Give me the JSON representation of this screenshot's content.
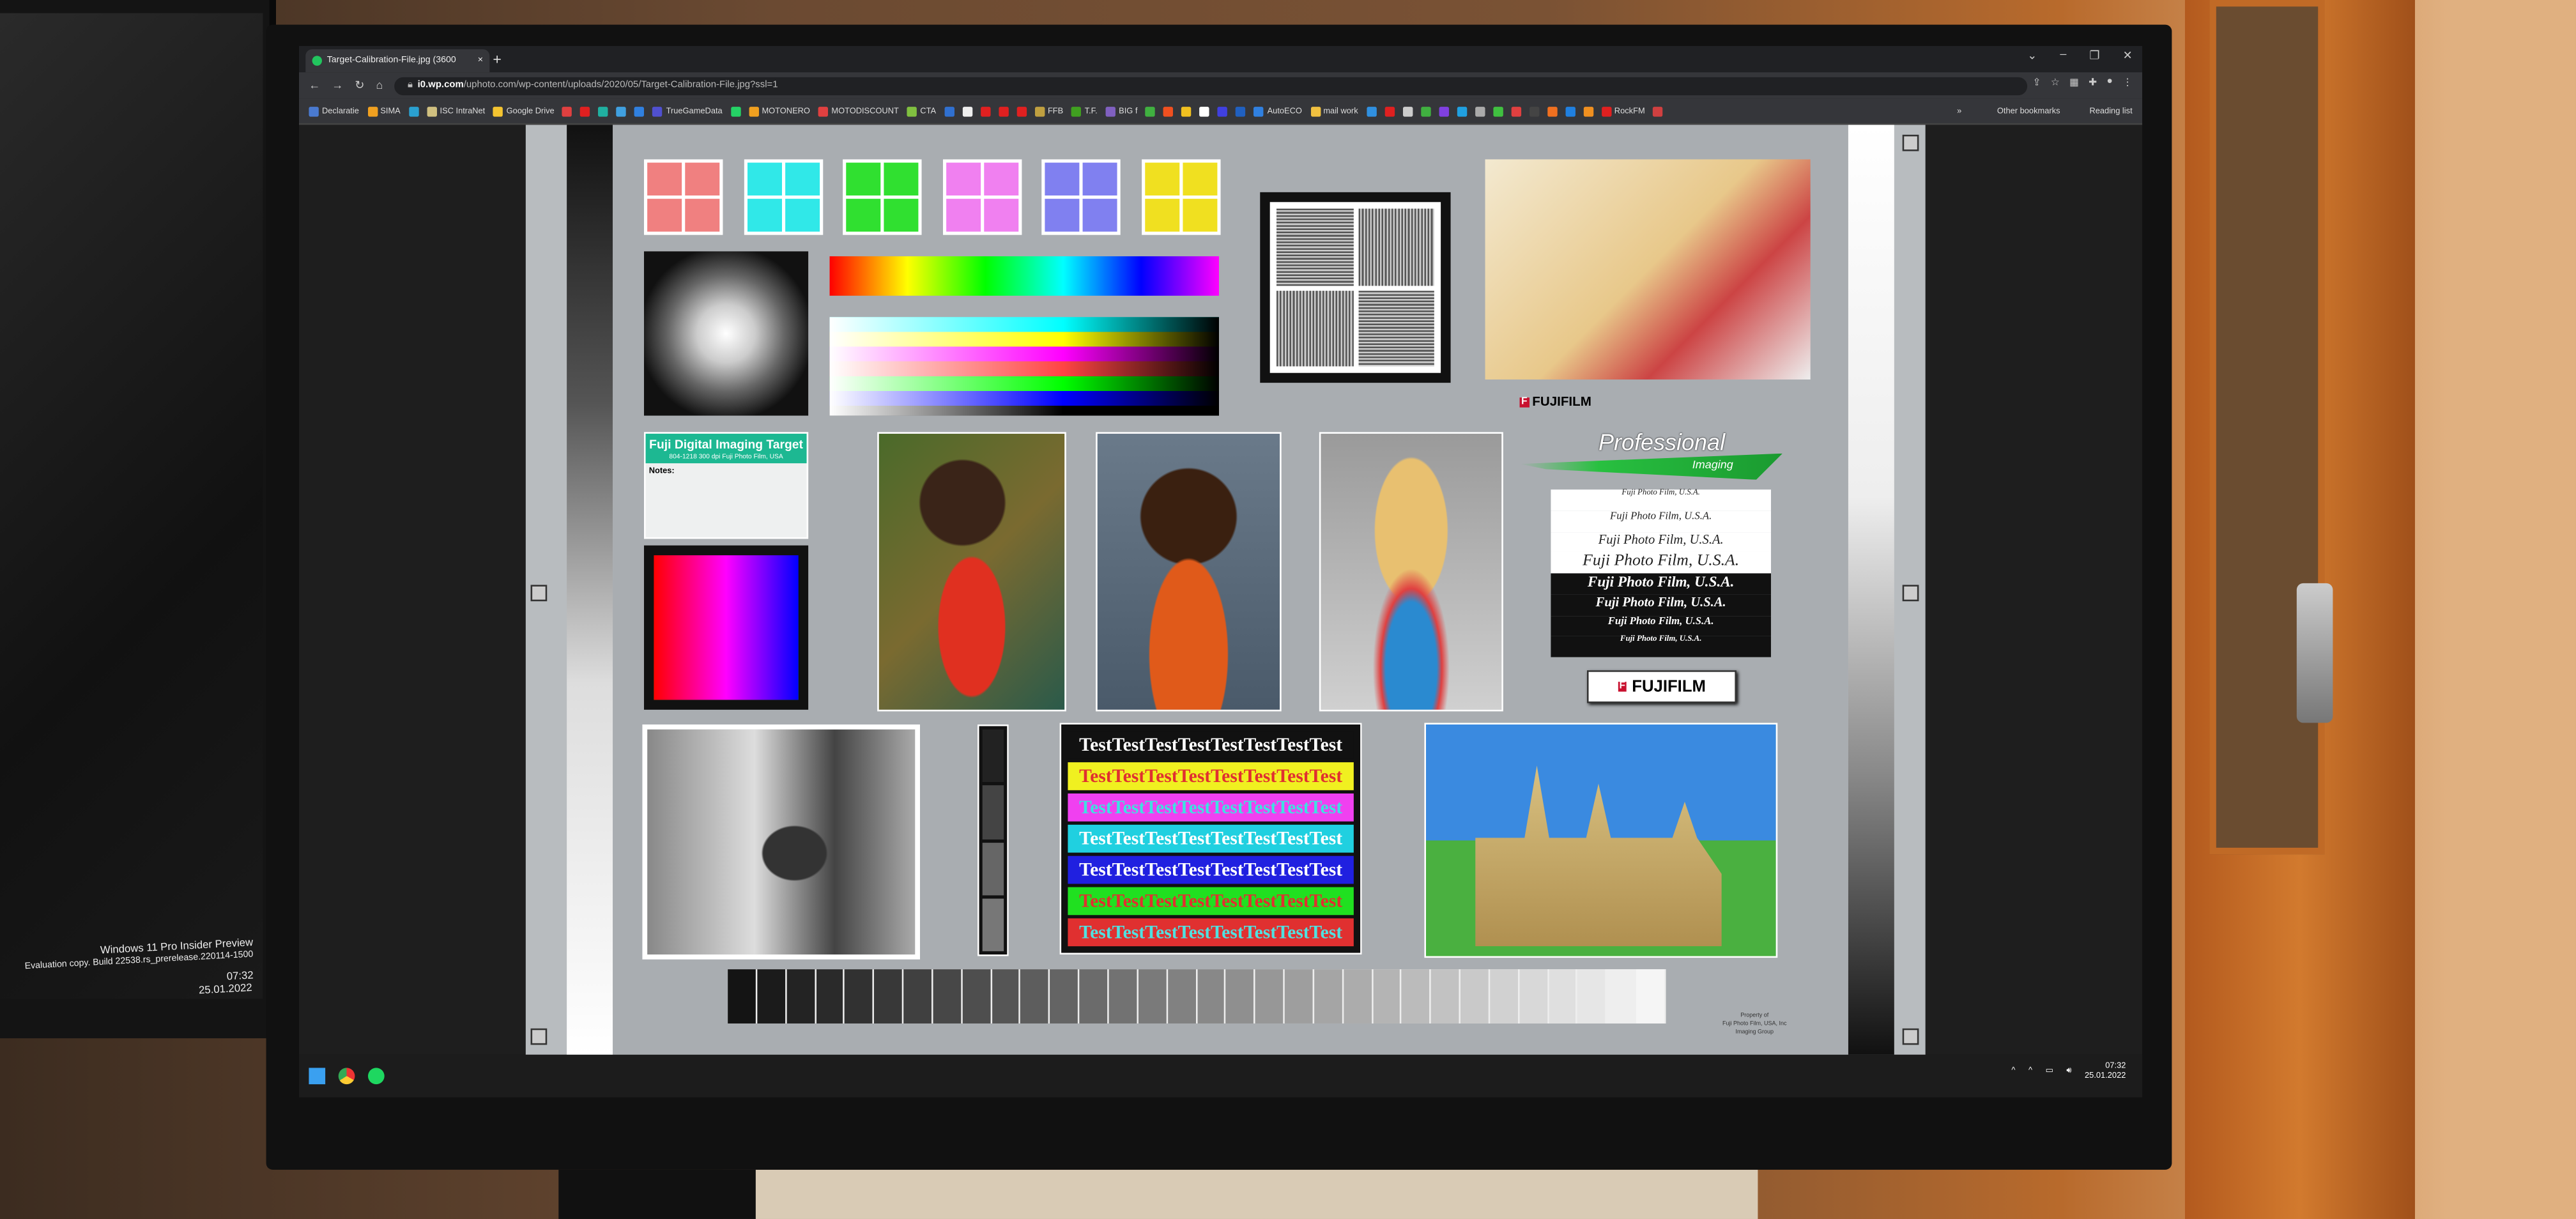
{
  "left_monitor": {
    "watermark_line1": "Windows 11 Pro Insider Preview",
    "watermark_line2": "Evaluation copy. Build 22538.rs_prerelease.220114-1500",
    "time": "07:32",
    "date": "25.01.2022"
  },
  "browser": {
    "tab": {
      "title": "Target-Calibration-File.jpg (3600",
      "close": "×"
    },
    "new_tab": "+",
    "window_controls": [
      "⌄",
      "–",
      "❐",
      "✕"
    ],
    "nav": {
      "back": "←",
      "forward": "→",
      "reload": "↻",
      "home": "⌂"
    },
    "url": {
      "domain": "i0.wp.com",
      "path": "/uphoto.com/wp-content/uploads/2020/05/Target-Calibration-File.jpg?ssl=1"
    },
    "bookmarks": [
      {
        "label": "Declaratie",
        "color": "#4a7ad0"
      },
      {
        "label": "SIMA",
        "color": "#f0a020"
      },
      {
        "label": "",
        "color": "#2aa0d0"
      },
      {
        "label": "ISC IntraNet",
        "color": "#d0c080"
      },
      {
        "label": "Google Drive",
        "color": "#f4c430"
      },
      {
        "label": "",
        "color": "#e04040"
      },
      {
        "label": "",
        "color": "#e02020"
      },
      {
        "label": "",
        "color": "#20b0a0"
      },
      {
        "label": "",
        "color": "#40a0e0"
      },
      {
        "label": "",
        "color": "#3080e0"
      },
      {
        "label": "TrueGameData",
        "color": "#5050d0"
      },
      {
        "label": "",
        "color": "#25d366"
      },
      {
        "label": "MOTONERO",
        "color": "#f0a020"
      },
      {
        "label": "MOTODISCOUNT",
        "color": "#e04040"
      },
      {
        "label": "CTA",
        "color": "#80c040"
      },
      {
        "label": "",
        "color": "#3070d0"
      },
      {
        "label": "",
        "color": "#eeeeee"
      },
      {
        "label": "",
        "color": "#e02020"
      },
      {
        "label": "",
        "color": "#e02020"
      },
      {
        "label": "",
        "color": "#e02020"
      },
      {
        "label": "FFB",
        "color": "#c0a040"
      },
      {
        "label": "T.F.",
        "color": "#40a020"
      },
      {
        "label": "BIG f",
        "color": "#8060c0"
      },
      {
        "label": "",
        "color": "#40b040"
      },
      {
        "label": "",
        "color": "#f05020"
      },
      {
        "label": "",
        "color": "#f0c020"
      },
      {
        "label": "",
        "color": "#ffffff"
      },
      {
        "label": "",
        "color": "#4040e0"
      },
      {
        "label": "",
        "color": "#2060c0"
      },
      {
        "label": "AutoECO",
        "color": "#3080e0"
      },
      {
        "label": "mail work",
        "color": "#f0c040"
      },
      {
        "label": "",
        "color": "#3090e0"
      },
      {
        "label": "",
        "color": "#e02020"
      },
      {
        "label": "",
        "color": "#cccccc"
      },
      {
        "label": "",
        "color": "#40b040"
      },
      {
        "label": "",
        "color": "#8040e0"
      },
      {
        "label": "",
        "color": "#20a0e0"
      },
      {
        "label": "",
        "color": "#aaaaaa"
      },
      {
        "label": "",
        "color": "#40c040"
      },
      {
        "label": "",
        "color": "#e04040"
      },
      {
        "label": "",
        "color": "#444444"
      },
      {
        "label": "",
        "color": "#f07020"
      },
      {
        "label": "",
        "color": "#2080e0"
      },
      {
        "label": "",
        "color": "#f09020"
      },
      {
        "label": "RockFM",
        "color": "#e02020"
      },
      {
        "label": "",
        "color": "#d04040"
      }
    ],
    "bookmarks_overflow": "»",
    "other_bookmarks": "Other bookmarks",
    "reading_list": "Reading list"
  },
  "target": {
    "swatch_colors": [
      "#f08080",
      "#30e8e8",
      "#30e030",
      "#f080f0",
      "#8080f0",
      "#f0e020"
    ],
    "label": {
      "title": "Fuji Digital Imaging Target",
      "line2": "804-1218  300 dpi    Fuji Photo Film, USA",
      "notes": "Notes:",
      "color": "#1db892"
    },
    "fujifilm_logo": "FUJIFILM",
    "professional": "Professional",
    "imaging": "Imaging",
    "fuji_lines": [
      "Fuji Photo Film, U.S.A.",
      "Fuji Photo Film, U.S.A.",
      "Fuji Photo Film, U.S.A.",
      "Fuji Photo Film, U.S.A.",
      "Fuji Photo Film, U.S.A.",
      "Fuji Photo Film, U.S.A.",
      "Fuji Photo Film, U.S.A.",
      "Fuji Photo Film, U.S.A."
    ],
    "badge": "FUJIFILM",
    "badge_mark": "F",
    "test_rows": [
      {
        "text": "TestTestTestTestTestTestTestTest",
        "bg": "#111111",
        "fg": "#ffffff"
      },
      {
        "text": "TestTestTestTestTestTestTestTest",
        "bg": "#f0f020",
        "fg": "#e03030"
      },
      {
        "text": "TestTestTestTestTestTestTestTest",
        "bg": "#f040f0",
        "fg": "#40e0e0"
      },
      {
        "text": "TestTestTestTestTestTestTestTest",
        "bg": "#20d0e0",
        "fg": "#ffffff"
      },
      {
        "text": "TestTestTestTestTestTestTestTest",
        "bg": "#2020e0",
        "fg": "#ffffff"
      },
      {
        "text": "TestTestTestTestTestTestTestTest",
        "bg": "#20e020",
        "fg": "#e03030"
      },
      {
        "text": "TestTestTestTestTestTestTestTest",
        "bg": "#e03030",
        "fg": "#50e0e0"
      }
    ],
    "property": [
      "Property of",
      "Fuji Photo Film, USA, Inc",
      "Imaging Group"
    ]
  },
  "taskbar": {
    "time": "07:32",
    "date": "25.01.2022",
    "tray_icons": [
      "chevron-up",
      "chevron-up",
      "network",
      "volume"
    ]
  }
}
